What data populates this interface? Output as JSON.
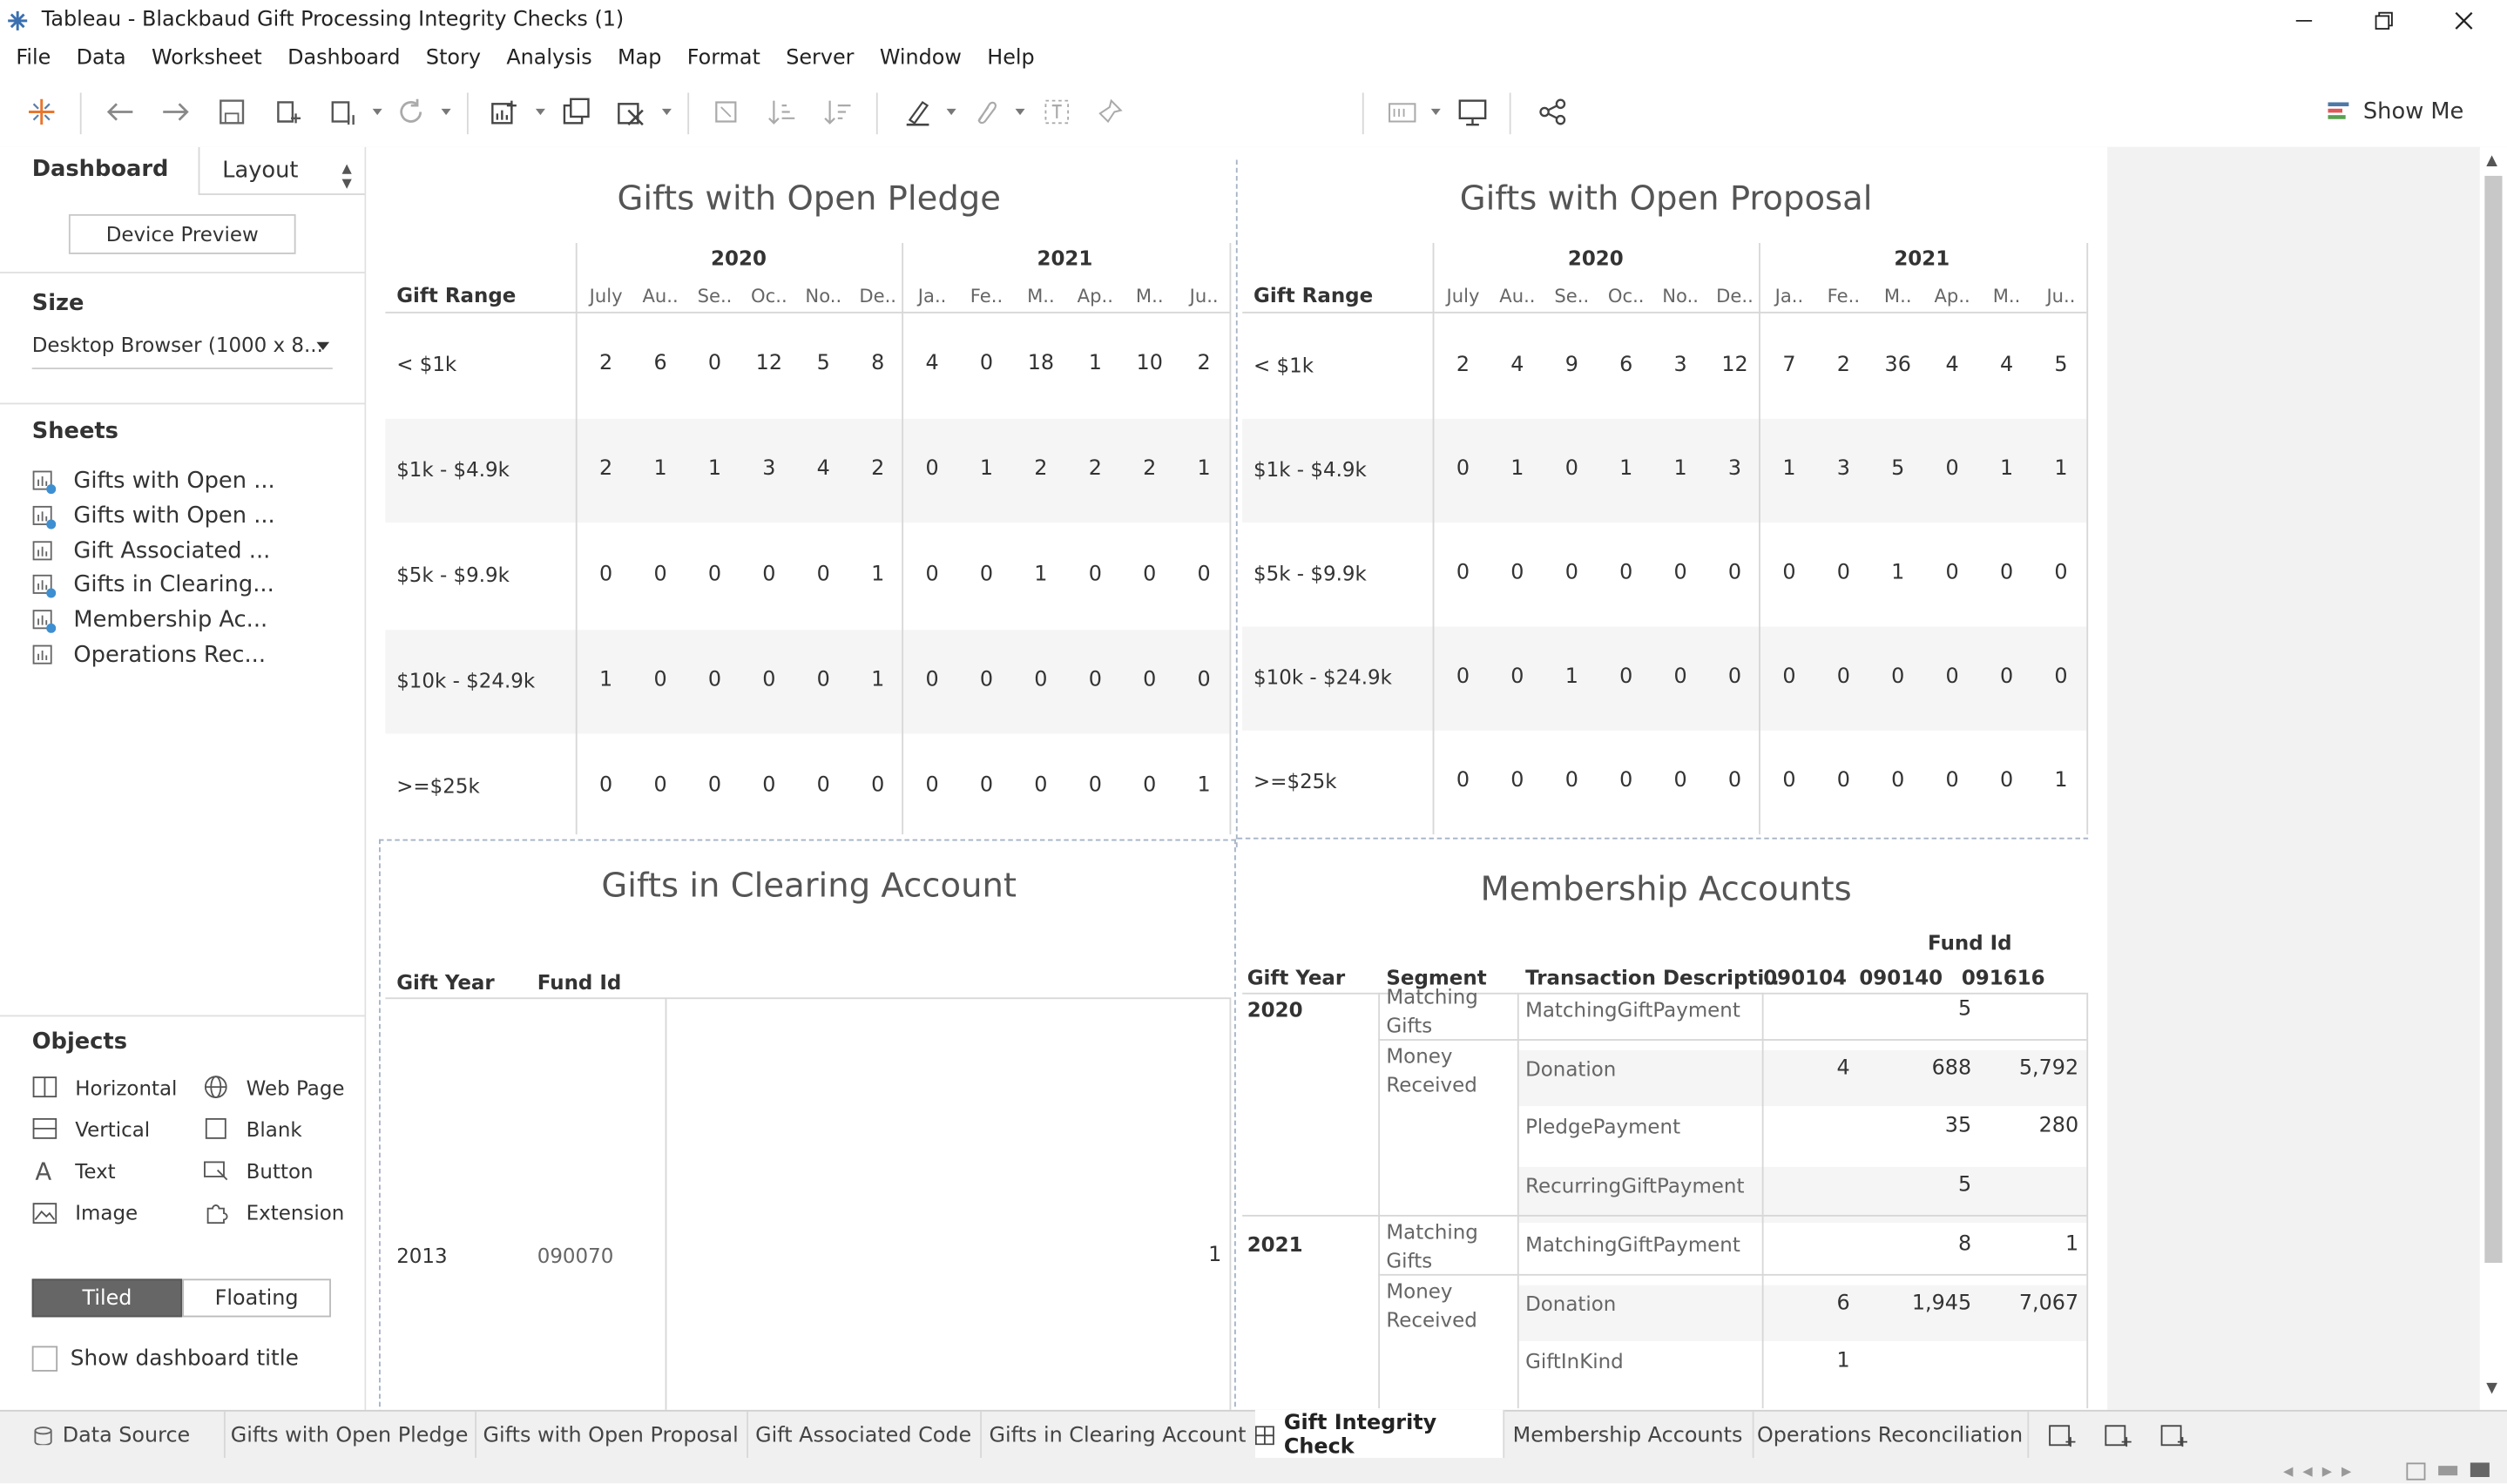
{
  "window": {
    "title": "Tableau - Blackbaud Gift Processing Integrity Checks (1)"
  },
  "menu": [
    "File",
    "Data",
    "Worksheet",
    "Dashboard",
    "Story",
    "Analysis",
    "Map",
    "Format",
    "Server",
    "Window",
    "Help"
  ],
  "toolbar": {
    "show_me_label": "Show Me"
  },
  "leftpane": {
    "tab_dashboard": "Dashboard",
    "tab_layout": "Layout",
    "device_preview": "Device Preview",
    "size_title": "Size",
    "size_value": "Desktop Browser (1000 x 8...",
    "sheets_title": "Sheets",
    "sheets": [
      "Gifts with Open ...",
      "Gifts with Open ...",
      "Gift Associated ...",
      "Gifts in Clearing...",
      "Membership Ac...",
      "Operations Rec..."
    ],
    "objects_title": "Objects",
    "objects": [
      "Horizontal",
      "Web Page",
      "Vertical",
      "Blank",
      "Text",
      "Button",
      "Image",
      "Extension"
    ],
    "tiled": "Tiled",
    "floating": "Floating",
    "show_title": "Show dashboard title"
  },
  "pledge": {
    "title": "Gifts with Open Pledge",
    "row_header": "Gift Range",
    "years": [
      "2020",
      "2021"
    ],
    "months": [
      "July",
      "Au..",
      "Se..",
      "Oc..",
      "No..",
      "De..",
      "Ja..",
      "Fe..",
      "M..",
      "Ap..",
      "M..",
      "Ju.."
    ],
    "rows": [
      {
        "label": "< $1k",
        "values": [
          "2",
          "6",
          "0",
          "12",
          "5",
          "8",
          "4",
          "0",
          "18",
          "1",
          "10",
          "2"
        ]
      },
      {
        "label": "$1k - $4.9k",
        "values": [
          "2",
          "1",
          "1",
          "3",
          "4",
          "2",
          "0",
          "1",
          "2",
          "2",
          "2",
          "1"
        ]
      },
      {
        "label": "$5k - $9.9k",
        "values": [
          "0",
          "0",
          "0",
          "0",
          "0",
          "1",
          "0",
          "0",
          "1",
          "0",
          "0",
          "0"
        ]
      },
      {
        "label": "$10k - $24.9k",
        "values": [
          "1",
          "0",
          "0",
          "0",
          "0",
          "1",
          "0",
          "0",
          "0",
          "0",
          "0",
          "0"
        ]
      },
      {
        "label": ">=$25k",
        "values": [
          "0",
          "0",
          "0",
          "0",
          "0",
          "0",
          "0",
          "0",
          "0",
          "0",
          "0",
          "1"
        ]
      }
    ]
  },
  "proposal": {
    "title": "Gifts with Open Proposal",
    "row_header": "Gift Range",
    "years": [
      "2020",
      "2021"
    ],
    "months": [
      "July",
      "Au..",
      "Se..",
      "Oc..",
      "No..",
      "De..",
      "Ja..",
      "Fe..",
      "M..",
      "Ap..",
      "M..",
      "Ju.."
    ],
    "rows": [
      {
        "label": "< $1k",
        "values": [
          "2",
          "4",
          "9",
          "6",
          "3",
          "12",
          "7",
          "2",
          "36",
          "4",
          "4",
          "5"
        ]
      },
      {
        "label": "$1k - $4.9k",
        "values": [
          "0",
          "1",
          "0",
          "1",
          "1",
          "3",
          "1",
          "3",
          "5",
          "0",
          "1",
          "1"
        ]
      },
      {
        "label": "$5k - $9.9k",
        "values": [
          "0",
          "0",
          "0",
          "0",
          "0",
          "0",
          "0",
          "0",
          "1",
          "0",
          "0",
          "0"
        ]
      },
      {
        "label": "$10k - $24.9k",
        "values": [
          "0",
          "0",
          "1",
          "0",
          "0",
          "0",
          "0",
          "0",
          "0",
          "0",
          "0",
          "0"
        ]
      },
      {
        "label": ">=$25k",
        "values": [
          "0",
          "0",
          "0",
          "0",
          "0",
          "0",
          "0",
          "0",
          "0",
          "0",
          "0",
          "1"
        ]
      }
    ]
  },
  "clearing": {
    "title": "Gifts in Clearing Account",
    "col_year": "Gift Year",
    "col_fund": "Fund Id",
    "row": {
      "year": "2013",
      "fund": "090070",
      "value": "1"
    }
  },
  "membership": {
    "title": "Membership Accounts",
    "fund_header": "Fund Id",
    "col_year": "Gift Year",
    "col_segment": "Segment",
    "col_desc": "Transaction Descripti..",
    "funds": [
      "090104",
      "090140",
      "091616"
    ],
    "rows": [
      {
        "year": "2020",
        "segment": "Matching Gifts",
        "desc": "MatchingGiftPayment",
        "v": [
          "",
          "5",
          ""
        ]
      },
      {
        "year": "",
        "segment": "Money Received",
        "desc": "Donation",
        "v": [
          "4",
          "688",
          "5,792"
        ]
      },
      {
        "year": "",
        "segment": "",
        "desc": "PledgePayment",
        "v": [
          "",
          "35",
          "280"
        ]
      },
      {
        "year": "",
        "segment": "",
        "desc": "RecurringGiftPayment",
        "v": [
          "",
          "5",
          ""
        ]
      },
      {
        "year": "2021",
        "segment": "Matching Gifts",
        "desc": "MatchingGiftPayment",
        "v": [
          "",
          "8",
          "1"
        ]
      },
      {
        "year": "",
        "segment": "Money Received",
        "desc": "Donation",
        "v": [
          "6",
          "1,945",
          "7,067"
        ]
      },
      {
        "year": "",
        "segment": "",
        "desc": "GiftInKind",
        "v": [
          "1",
          "",
          ""
        ]
      }
    ]
  },
  "bottom_tabs": [
    "Data Source",
    "Gifts with Open Pledge",
    "Gifts with Open Proposal",
    "Gift Associated Code",
    "Gifts in Clearing Account",
    "Gift Integrity Check",
    "Membership Accounts",
    "Operations Reconciliation"
  ]
}
